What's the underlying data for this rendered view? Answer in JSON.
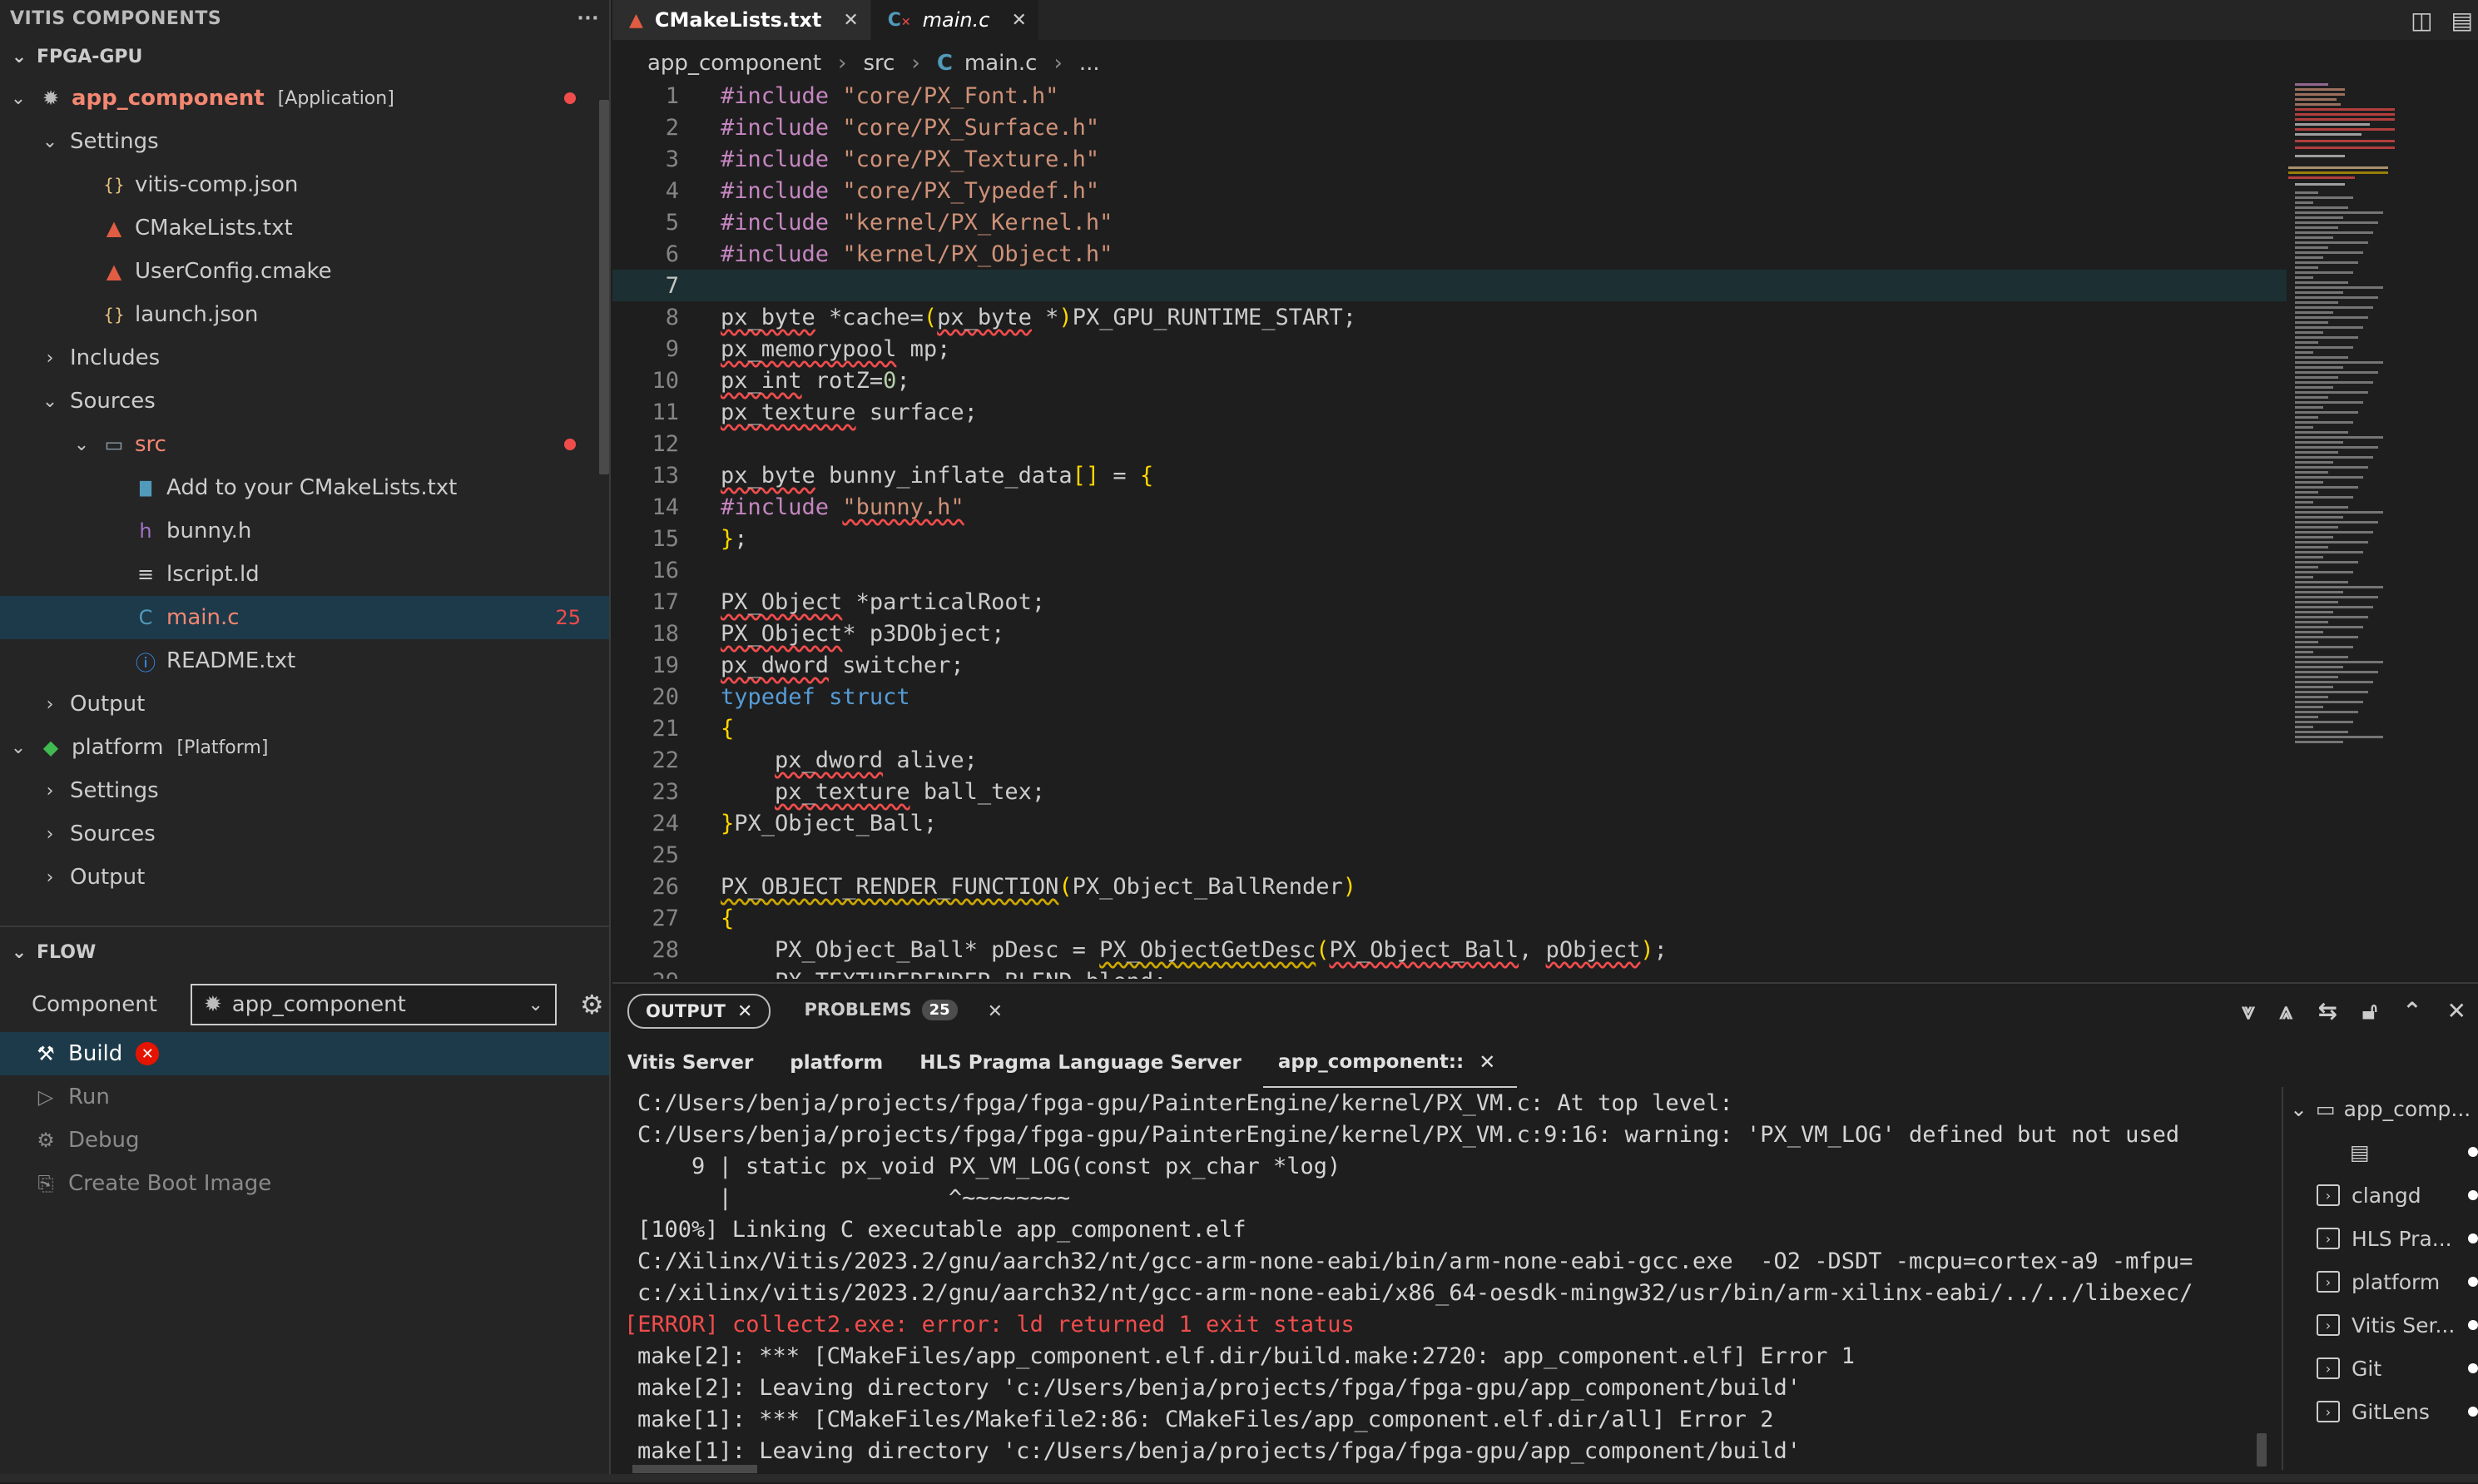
{
  "sidebar": {
    "title": "VITIS COMPONENTS",
    "more": "···",
    "workspace": "FPGA-GPU",
    "tree": [
      {
        "level": 0,
        "chev": "⌄",
        "icon": "component",
        "label": "app_component",
        "tag": "[Application]",
        "err": true,
        "dot": true
      },
      {
        "level": 1,
        "chev": "⌄",
        "icon": "",
        "label": "Settings"
      },
      {
        "level": 2,
        "chev": "",
        "icon": "json",
        "label": "vitis-comp.json"
      },
      {
        "level": 2,
        "chev": "",
        "icon": "cmake",
        "label": "CMakeLists.txt"
      },
      {
        "level": 2,
        "chev": "",
        "icon": "cmake",
        "label": "UserConfig.cmake"
      },
      {
        "level": 2,
        "chev": "",
        "icon": "json",
        "label": "launch.json"
      },
      {
        "level": 1,
        "chev": "›",
        "icon": "",
        "label": "Includes"
      },
      {
        "level": 1,
        "chev": "⌄",
        "icon": "",
        "label": "Sources"
      },
      {
        "level": 2,
        "chev": "⌄",
        "icon": "folder",
        "label": "src",
        "err": true,
        "dot": true
      },
      {
        "level": 3,
        "chev": "",
        "icon": "file",
        "label": "Add to your CMakeLists.txt"
      },
      {
        "level": 3,
        "chev": "",
        "icon": "h",
        "label": "bunny.h"
      },
      {
        "level": 3,
        "chev": "",
        "icon": "lines",
        "label": "lscript.ld"
      },
      {
        "level": 3,
        "chev": "",
        "icon": "c",
        "label": "main.c",
        "err": true,
        "count": "25",
        "selected": true
      },
      {
        "level": 3,
        "chev": "",
        "icon": "info",
        "label": "README.txt"
      },
      {
        "level": 1,
        "chev": "›",
        "icon": "",
        "label": "Output"
      },
      {
        "level": 0,
        "chev": "⌄",
        "icon": "platform",
        "label": "platform",
        "tag": "[Platform]"
      },
      {
        "level": 1,
        "chev": "›",
        "icon": "",
        "label": "Settings"
      },
      {
        "level": 1,
        "chev": "›",
        "icon": "",
        "label": "Sources"
      },
      {
        "level": 1,
        "chev": "›",
        "icon": "",
        "label": "Output"
      }
    ]
  },
  "flow": {
    "title": "FLOW",
    "component_label": "Component",
    "component_value": "app_component",
    "items": [
      {
        "label": "Build",
        "icon": "hammer-icon",
        "active": true,
        "error": "✕"
      },
      {
        "label": "Run",
        "icon": "play-icon"
      },
      {
        "label": "Debug",
        "icon": "debug-icon"
      },
      {
        "label": "Create Boot Image",
        "icon": "boot-image-icon"
      }
    ]
  },
  "tabs": [
    {
      "label": "CMakeLists.txt",
      "icon": "cmake-icon",
      "active": false
    },
    {
      "label": "main.c",
      "icon": "c-file-icon",
      "active": true
    }
  ],
  "breadcrumb": [
    "app_component",
    "src",
    "main.c",
    "..."
  ],
  "code": [
    {
      "n": "1",
      "html": "<span class='kw'>#include</span> <span class='str'>\"core/PX_Font.h\"</span>"
    },
    {
      "n": "2",
      "html": "<span class='kw'>#include</span> <span class='str'>\"core/PX_Surface.h\"</span>"
    },
    {
      "n": "3",
      "html": "<span class='kw'>#include</span> <span class='str'>\"core/PX_Texture.h\"</span>"
    },
    {
      "n": "4",
      "html": "<span class='kw'>#include</span> <span class='str'>\"core/PX_Typedef.h\"</span>"
    },
    {
      "n": "5",
      "html": "<span class='kw'>#include</span> <span class='str'>\"kernel/PX_Kernel.h\"</span>"
    },
    {
      "n": "6",
      "html": "<span class='kw'>#include</span> <span class='str'>\"kernel/PX_Object.h\"</span>"
    },
    {
      "n": "7",
      "html": "",
      "current": true
    },
    {
      "n": "8",
      "html": "<span class='sq'>px_byte</span> *cache=<span class='br'>(</span><span class='sq'>px_byte</span> *<span class='br'>)</span>PX_GPU_RUNTIME_START;"
    },
    {
      "n": "9",
      "html": "<span class='sq'>px_memorypool</span> mp;"
    },
    {
      "n": "10",
      "html": "<span class='sq'>px_int</span> rotZ=<span class='num'>0</span>;"
    },
    {
      "n": "11",
      "html": "<span class='sq'>px_texture</span> surface;"
    },
    {
      "n": "12",
      "html": ""
    },
    {
      "n": "13",
      "html": "<span class='sq'>px_byte</span> bunny_inflate_data<span class='br'>[]</span> = <span class='br'>{</span>"
    },
    {
      "n": "14",
      "html": "<span class='kw'>#include</span> <span class='str sq'>\"bunny.h\"</span>"
    },
    {
      "n": "15",
      "html": "<span class='br'>}</span>;"
    },
    {
      "n": "16",
      "html": ""
    },
    {
      "n": "17",
      "html": "<span class='sq'>PX_Object</span> *particalRoot;"
    },
    {
      "n": "18",
      "html": "<span class='sq'>PX_Object</span>* p3DObject;"
    },
    {
      "n": "19",
      "html": "<span class='sq'>px_dword</span> switcher;"
    },
    {
      "n": "20",
      "html": "<span class='typ'>typedef</span> <span class='typ'>struct</span>"
    },
    {
      "n": "21",
      "html": "<span class='br'>{</span>"
    },
    {
      "n": "22",
      "html": "    <span class='sq'>px_dword</span> alive;"
    },
    {
      "n": "23",
      "html": "    <span class='sq'>px_texture</span> ball_tex;"
    },
    {
      "n": "24",
      "html": "<span class='br'>}</span>PX_Object_Ball;"
    },
    {
      "n": "25",
      "html": ""
    },
    {
      "n": "26",
      "html": "<span class='sqy'>PX_OBJECT_RENDER_FUNCTION</span><span class='br'>(</span>PX_Object_BallRender<span class='br'>)</span>"
    },
    {
      "n": "27",
      "html": "<span class='br'>{</span>"
    },
    {
      "n": "28",
      "html": "    PX_Object_Ball* pDesc = <span class='sqy'>PX_ObjectGetDesc</span><span class='br'>(</span><span class='sq'>PX_Object_Ball</span>, <span class='sq'>pObject</span><span class='br'>)</span>;"
    },
    {
      "n": "29",
      "html": "    PX_TEXTURERENDER_BLEND blend;"
    }
  ],
  "panel": {
    "tabs": [
      {
        "label": "OUTPUT",
        "active": true
      },
      {
        "label": "PROBLEMS",
        "badge": "25"
      }
    ],
    "terminal_tabs": [
      "Vitis Server",
      "platform",
      "HLS Pragma Language Server",
      "app_component::"
    ],
    "output": [
      {
        "text": "C:/Users/benja/projects/fpga/fpga-gpu/PainterEngine/kernel/PX_VM.c: At top level:"
      },
      {
        "text": "C:/Users/benja/projects/fpga/fpga-gpu/PainterEngine/kernel/PX_VM.c:9:16: warning: 'PX_VM_LOG' defined but not used"
      },
      {
        "text": "    9 | static px_void PX_VM_LOG(const px_char *log)"
      },
      {
        "text": "      |                ^~~~~~~~~"
      },
      {
        "text": "[100%] Linking C executable app_component.elf"
      },
      {
        "text": "C:/Xilinx/Vitis/2023.2/gnu/aarch32/nt/gcc-arm-none-eabi/bin/arm-none-eabi-gcc.exe  -O2 -DSDT -mcpu=cortex-a9 -mfpu="
      },
      {
        "text": "c:/xilinx/vitis/2023.2/gnu/aarch32/nt/gcc-arm-none-eabi/x86_64-oesdk-mingw32/usr/bin/arm-xilinx-eabi/../../libexec/"
      },
      {
        "text": "[ERROR] collect2.exe: error: ld returned 1 exit status",
        "err": true
      },
      {
        "text": "make[2]: *** [CMakeFiles/app_component.elf.dir/build.make:2720: app_component.elf] Error 1"
      },
      {
        "text": "make[2]: Leaving directory 'c:/Users/benja/projects/fpga/fpga-gpu/app_component/build'"
      },
      {
        "text": "make[1]: *** [CMakeFiles/Makefile2:86: CMakeFiles/app_component.elf.dir/all] Error 2"
      },
      {
        "text": "make[1]: Leaving directory 'c:/Users/benja/projects/fpga/fpga-gpu/app_component/build'"
      }
    ],
    "terminal_list": [
      {
        "label": "app_comp...",
        "kind": "folder"
      },
      {
        "label": "",
        "kind": "doc"
      },
      {
        "label": "clangd"
      },
      {
        "label": "HLS Pra..."
      },
      {
        "label": "platform"
      },
      {
        "label": "Vitis Ser..."
      },
      {
        "label": "Git"
      },
      {
        "label": "GitLens"
      }
    ]
  },
  "colors": {
    "error": "#f14c4c",
    "accent": "#007acc",
    "selected": "#1d3a4a"
  }
}
